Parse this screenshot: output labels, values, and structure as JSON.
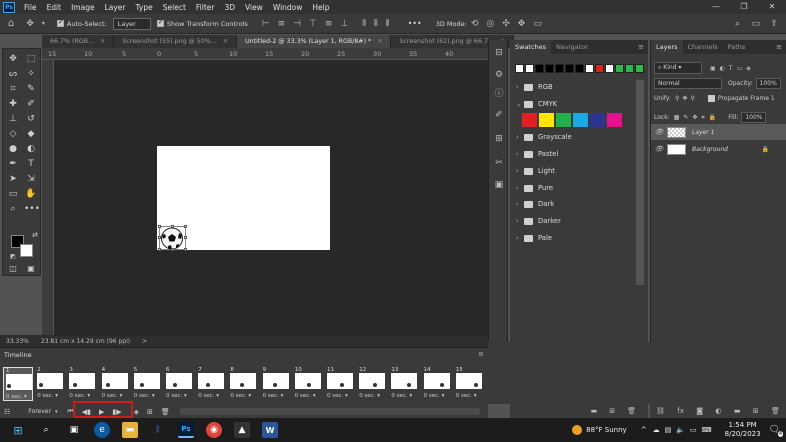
{
  "app": {
    "logo": "Ps",
    "menu": [
      "File",
      "Edit",
      "Image",
      "Layer",
      "Type",
      "Select",
      "Filter",
      "3D",
      "View",
      "Window",
      "Help"
    ],
    "window_controls": [
      "—",
      "❐",
      "✕"
    ]
  },
  "options_bar": {
    "auto_select_label": "Auto-Select:",
    "auto_select_value": "Layer",
    "transform_label": "Show Transform Controls",
    "more": "•••",
    "mode_3d_label": "3D Mode:"
  },
  "tabs": [
    {
      "label": "66.7% (RGB...",
      "active": false
    },
    {
      "label": "Screenshot (55).png @ 50%...",
      "active": false
    },
    {
      "label": "Untitled-2 @ 33.3% (Layer 1, RGB/8#) *",
      "active": true
    },
    {
      "label": "Screenshot (62).png @ 66.7...",
      "active": false
    }
  ],
  "ruler_labels": [
    "15",
    "10",
    "5",
    "0",
    "5",
    "10",
    "15",
    "20",
    "25",
    "30",
    "35",
    "40"
  ],
  "status": {
    "zoom": "33.33%",
    "doc_size": "23.81 cm x 14.29 cm (96 ppi)",
    "arrow": ">"
  },
  "swatches_panel": {
    "tabs": [
      "Swatches",
      "Navigator"
    ],
    "recent_colors": [
      "#ffffff",
      "#ffffff",
      "#000000",
      "#000000",
      "#000000",
      "#000000",
      "#000000",
      "#ffffff",
      "#e0201e",
      "#ffffff",
      "#2db84a",
      "#2db84a",
      "#2db84a"
    ],
    "cmyk_colors": [
      "#e21f26",
      "#ffe600",
      "#1fb04b",
      "#19a9e6",
      "#2c3490",
      "#e6118c"
    ],
    "groups": [
      {
        "name": "RGB",
        "expanded": false
      },
      {
        "name": "CMYK",
        "expanded": true
      },
      {
        "name": "Grayscale",
        "expanded": false
      },
      {
        "name": "Pastel",
        "expanded": false
      },
      {
        "name": "Light",
        "expanded": false
      },
      {
        "name": "Pure",
        "expanded": false
      },
      {
        "name": "Dark",
        "expanded": false
      },
      {
        "name": "Darker",
        "expanded": false
      },
      {
        "name": "Pale",
        "expanded": false
      }
    ]
  },
  "layers_panel": {
    "tabs": [
      "Layers",
      "Channels",
      "Paths"
    ],
    "kind_label": "Kind",
    "blend_mode": "Normal",
    "opacity_label": "Opacity:",
    "opacity_value": "100%",
    "unify_label": "Unify:",
    "propagate_label": "Propagate Frame 1",
    "lock_label": "Lock:",
    "fill_label": "Fill:",
    "fill_value": "100%",
    "layers": [
      {
        "name": "Layer 1",
        "selected": true
      },
      {
        "name": "Background",
        "selected": false
      }
    ]
  },
  "timeline": {
    "title": "Timeline",
    "frames": [
      {
        "num": "1",
        "delay": "0 sec."
      },
      {
        "num": "2",
        "delay": "0 sec."
      },
      {
        "num": "3",
        "delay": "0 sec."
      },
      {
        "num": "4",
        "delay": "0 sec."
      },
      {
        "num": "5",
        "delay": "0 sec."
      },
      {
        "num": "6",
        "delay": "0 sec."
      },
      {
        "num": "7",
        "delay": "0 sec."
      },
      {
        "num": "8",
        "delay": "0 sec."
      },
      {
        "num": "9",
        "delay": "0 sec."
      },
      {
        "num": "10",
        "delay": "0 sec."
      },
      {
        "num": "11",
        "delay": "0 sec."
      },
      {
        "num": "12",
        "delay": "0 sec."
      },
      {
        "num": "13",
        "delay": "0 sec."
      },
      {
        "num": "14",
        "delay": "0 sec."
      },
      {
        "num": "15",
        "delay": "0 sec."
      }
    ],
    "loop_value": "Forever"
  },
  "taskbar": {
    "weather": "88°F  Sunny",
    "time": "1:54 PM",
    "date": "8/20/2023",
    "notif_count": "4"
  }
}
